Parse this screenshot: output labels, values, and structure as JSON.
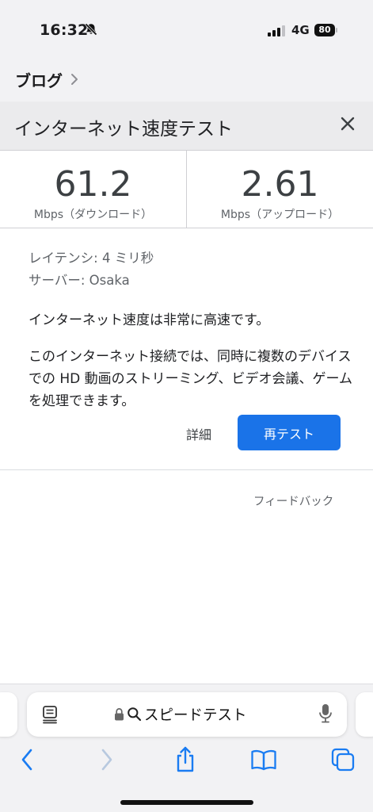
{
  "status_bar": {
    "time": "16:32",
    "network": "4G",
    "battery": "80",
    "icons": [
      "bell-slash-icon",
      "signal-icon",
      "battery-icon"
    ]
  },
  "breadcrumb": {
    "label": "ブログ",
    "icon": "chevron-right-icon"
  },
  "card": {
    "title": "インターネット速度テスト",
    "close_icon": "close-icon",
    "download": {
      "value": "61.2",
      "unit": "Mbps（ダウンロード）"
    },
    "upload": {
      "value": "2.61",
      "unit": "Mbps（アップロード）"
    },
    "latency": "レイテンシ: 4 ミリ秒",
    "server": "サーバー: Osaka",
    "summary": "インターネット速度は非常に高速です。",
    "description": "このインターネット接続では、同時に複数のデバイスでの HD 動画のストリーミング、ビデオ会議、ゲームを処理できます。",
    "details_label": "詳細",
    "retest_label": "再テスト",
    "feedback_label": "フィードバック"
  },
  "browser": {
    "address_text": "スピードテスト",
    "icons": [
      "reader-mode-icon",
      "lock-icon",
      "search-icon",
      "microphone-icon",
      "back-icon",
      "forward-icon",
      "share-icon",
      "bookmarks-icon",
      "tabs-icon"
    ]
  },
  "colors": {
    "accent": "#1a73e8",
    "nav_active": "#1a7cf2",
    "nav_disabled": "#b8c9df"
  }
}
